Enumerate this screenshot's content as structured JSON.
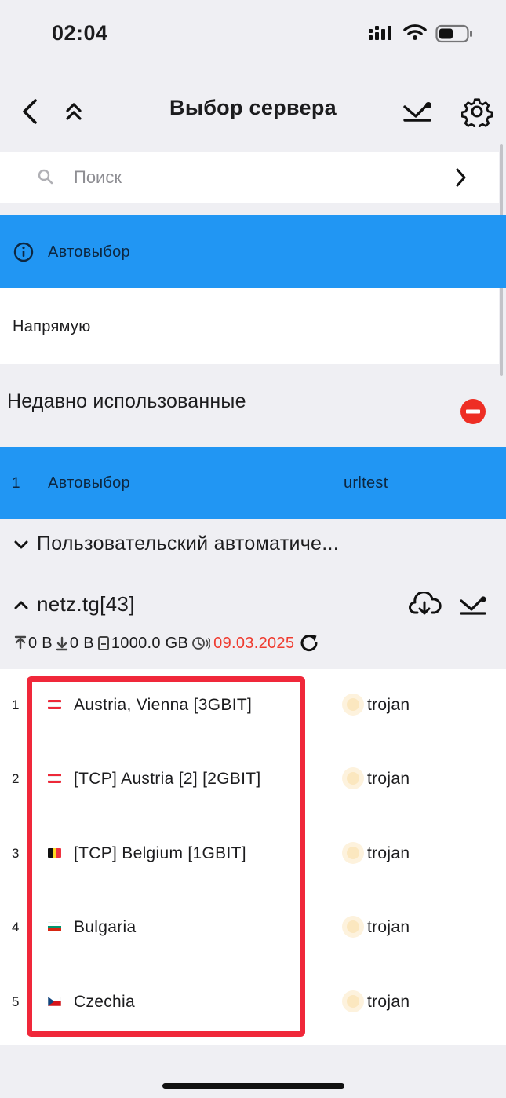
{
  "status_bar": {
    "time": "02:04"
  },
  "app_bar": {
    "title": "Выбор сервера"
  },
  "search": {
    "placeholder": "Поиск"
  },
  "autoselect": {
    "label": "Автовыбор"
  },
  "direct": {
    "label": "Напрямую"
  },
  "recent": {
    "title": "Недавно использованные",
    "items": [
      {
        "index": "1",
        "name": "Автовыбор",
        "type": "urltest"
      }
    ]
  },
  "groups": [
    {
      "title": "Пользовательский автоматиче...",
      "expanded": false
    },
    {
      "title": "netz.tg[43]",
      "expanded": true,
      "stats": {
        "upload": "0 B",
        "download": "0 B",
        "total": "1000.0 GB",
        "expire": "09.03.2025"
      },
      "servers": [
        {
          "index": "1",
          "name": "Austria, Vienna [3GBIT]",
          "type": "trojan",
          "flag": "austria-flag-icon"
        },
        {
          "index": "2",
          "name": "[TCP] Austria [2] [2GBIT]",
          "type": "trojan",
          "flag": "austria-flag-icon"
        },
        {
          "index": "3",
          "name": "[TCP] Belgium [1GBIT]",
          "type": "trojan",
          "flag": "belgium-flag-icon"
        },
        {
          "index": "4",
          "name": "Bulgaria",
          "type": "trojan",
          "flag": "bulgaria-flag-icon"
        },
        {
          "index": "5",
          "name": "Czechia",
          "type": "trojan",
          "flag": "czechia-flag-icon"
        }
      ]
    }
  ],
  "colors": {
    "selected": "#2196f3",
    "expire": "#ef3b2f",
    "highlight": "#f0283a",
    "background": "#efeff3"
  }
}
